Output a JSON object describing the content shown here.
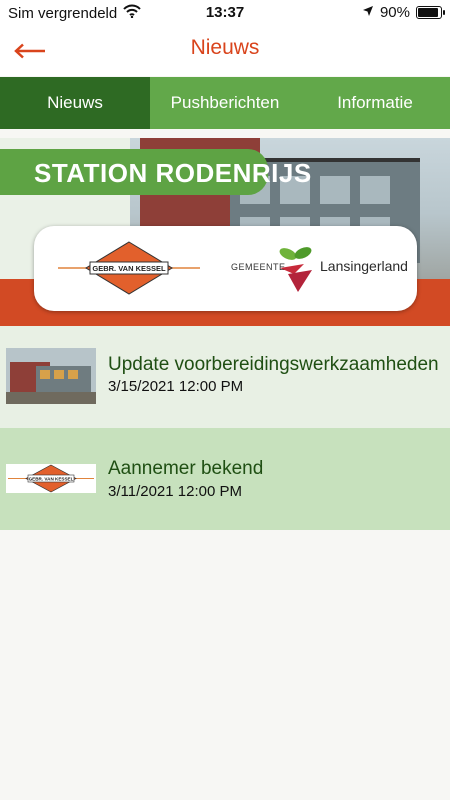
{
  "status_bar": {
    "carrier": "Sim vergrendeld",
    "time": "13:37",
    "battery": "90%",
    "battery_level": 0.9,
    "icons": [
      "wifi-icon",
      "location-arrow-icon",
      "battery-icon"
    ]
  },
  "header": {
    "title": "Nieuws",
    "back_icon": "arrow-left-icon"
  },
  "tabs": [
    {
      "label": "Nieuws",
      "active": true
    },
    {
      "label": "Pushberichten",
      "active": false
    },
    {
      "label": "Informatie",
      "active": false
    }
  ],
  "banner": {
    "title": "STATION RODENRIJS",
    "logos": {
      "van_kessel": "GEBR. VAN KESSEL",
      "gemeente": "GEMEENTE",
      "lansingerland": "Lansingerland"
    }
  },
  "news": [
    {
      "title": "Update voorbereidingswerkzaamheden",
      "date": "3/15/2021 12:00 PM",
      "thumbnail": "station-photo"
    },
    {
      "title": "Aannemer bekend",
      "date": "3/11/2021 12:00 PM",
      "thumbnail": "van-kessel-logo"
    }
  ],
  "colors": {
    "accent": "#d9441c",
    "tab_bg": "#62a84a",
    "tab_active": "#2e6a23",
    "item_odd": "#e8f0e4",
    "item_even": "#c7e1bd",
    "title_green": "#1f4f13"
  }
}
